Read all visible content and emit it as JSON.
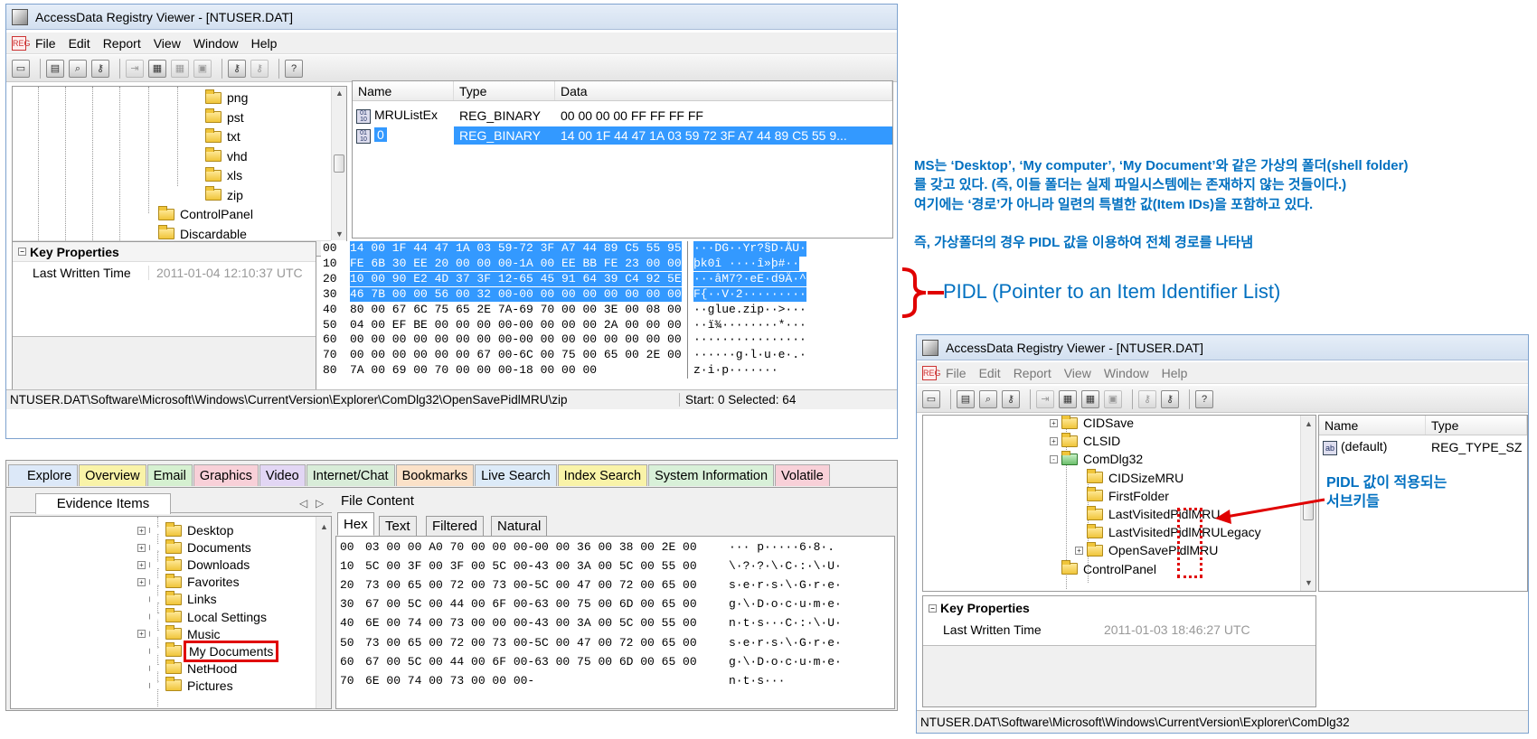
{
  "top_window": {
    "title": "AccessData Registry Viewer - [NTUSER.DAT]",
    "menu": [
      "File",
      "Edit",
      "Report",
      "View",
      "Window",
      "Help"
    ],
    "tree_items": [
      {
        "label": "png",
        "level": 2
      },
      {
        "label": "pst",
        "level": 2
      },
      {
        "label": "txt",
        "level": 2
      },
      {
        "label": "vhd",
        "level": 2
      },
      {
        "label": "xls",
        "level": 2
      },
      {
        "label": "zip",
        "level": 2,
        "open": true
      },
      {
        "label": "ControlPanel",
        "level": 1
      },
      {
        "label": "Discardable",
        "level": 1
      }
    ],
    "columns": [
      "Name",
      "Type",
      "Data"
    ],
    "values": [
      {
        "name": "MRUListEx",
        "type": "REG_BINARY",
        "data": "00 00 00 00 FF FF FF FF"
      },
      {
        "name": "0",
        "type": "REG_BINARY",
        "data": "14 00 1F 44 47 1A 03 59 72 3F A7 44 89 C5 55 9...",
        "selected": true
      }
    ],
    "key_properties_title": "Key Properties",
    "last_written_label": "Last Written Time",
    "last_written_value": "2011-01-04 12:10:37 UTC",
    "hex_rows": [
      {
        "off": "00",
        "hex": "14 00 1F 44 47 1A 03 59-72 3F A7 44 89 C5 55 95",
        "asc": "···DG··Yr?§D·ÅU·",
        "sel": true
      },
      {
        "off": "10",
        "hex": "FE 6B 30 EE 20 00 00 00-1A 00 EE BB FE 23 00 00",
        "asc": "þk0î ····î»þ#··",
        "sel": true
      },
      {
        "off": "20",
        "hex": "10 00 90 E2 4D 37 3F 12-65 45 91 64 39 C4 92 5E",
        "asc": "···âM7?·eE·d9Ä·^",
        "sel": true
      },
      {
        "off": "30",
        "hex": "46 7B 00 00 56 00 32 00-00 00 00 00 00 00 00 00",
        "asc": "F{··V·2·········",
        "sel": true
      },
      {
        "off": "40",
        "hex": "80 00 67 6C 75 65 2E 7A-69 70 00 00 3E 00 08 00",
        "asc": "··glue.zip··>···",
        "sel": false
      },
      {
        "off": "50",
        "hex": "04 00 EF BE 00 00 00 00-00 00 00 00 2A 00 00 00",
        "asc": "··ï¾········*···",
        "sel": false
      },
      {
        "off": "60",
        "hex": "00 00 00 00 00 00 00 00-00 00 00 00 00 00 00 00",
        "asc": "················",
        "sel": false
      },
      {
        "off": "70",
        "hex": "00 00 00 00 00 00 67 00-6C 00 75 00 65 00 2E 00",
        "asc": "······g·l·u·e·.·",
        "sel": false
      },
      {
        "off": "80",
        "hex": "7A 00 69 00 70 00 00 00-18 00 00 00",
        "asc": "z·i·p·······",
        "sel": false
      }
    ],
    "status_path": "NTUSER.DAT\\Software\\Microsoft\\Windows\\CurrentVersion\\Explorer\\ComDlg32\\OpenSavePidlMRU\\zip",
    "status_sel": "Start: 0 Selected: 64"
  },
  "ftk": {
    "tabs": [
      {
        "label": "Explore",
        "color": "#dce8f8"
      },
      {
        "label": "Overview",
        "color": "#f9f3a8"
      },
      {
        "label": "Email",
        "color": "#d5f0d0"
      },
      {
        "label": "Graphics",
        "color": "#f8d0d8"
      },
      {
        "label": "Video",
        "color": "#e2d6f4"
      },
      {
        "label": "Internet/Chat",
        "color": "#d8ecd8"
      },
      {
        "label": "Bookmarks",
        "color": "#fbe1c8"
      },
      {
        "label": "Live Search",
        "color": "#dceaf8"
      },
      {
        "label": "Index Search",
        "color": "#f9f3a8"
      },
      {
        "label": "System Information",
        "color": "#d8f0d8"
      },
      {
        "label": "Volatile",
        "color": "#f8d0d8"
      }
    ],
    "evidence_tab": "Evidence Items",
    "file_content": "File Content",
    "subtabs": [
      "Hex",
      "Text",
      "Filtered",
      "Natural"
    ],
    "tree": [
      {
        "label": "Desktop",
        "exp": true
      },
      {
        "label": "Documents",
        "exp": true
      },
      {
        "label": "Downloads",
        "exp": true
      },
      {
        "label": "Favorites",
        "exp": true
      },
      {
        "label": "Links",
        "exp": false
      },
      {
        "label": "Local Settings",
        "exp": false
      },
      {
        "label": "Music",
        "exp": true
      },
      {
        "label": "My Documents",
        "exp": false,
        "highlight": true
      },
      {
        "label": "NetHood",
        "exp": false
      },
      {
        "label": "Pictures",
        "exp": false
      }
    ],
    "hex_rows": [
      {
        "off": "00",
        "hex": "03 00 00 A0 70 00 00 00-00 00 36 00 38 00 2E 00",
        "asc": "··· p·····6·8·."
      },
      {
        "off": "10",
        "hex": "5C 00 3F 00 3F 00 5C 00-43 00 3A 00 5C 00 55 00",
        "asc": "\\·?·?·\\·C·:·\\·U·"
      },
      {
        "off": "20",
        "hex": "73 00 65 00 72 00 73 00-5C 00 47 00 72 00 65 00",
        "asc": "s·e·r·s·\\·G·r·e·"
      },
      {
        "off": "30",
        "hex": "67 00 5C 00 44 00 6F 00-63 00 75 00 6D 00 65 00",
        "asc": "g·\\·D·o·c·u·m·e·"
      },
      {
        "off": "40",
        "hex": "6E 00 74 00 73 00 00 00-43 00 3A 00 5C 00 55 00",
        "asc": "n·t·s···C·:·\\·U·"
      },
      {
        "off": "50",
        "hex": "73 00 65 00 72 00 73 00-5C 00 47 00 72 00 65 00",
        "asc": "s·e·r·s·\\·G·r·e·"
      },
      {
        "off": "60",
        "hex": "67 00 5C 00 44 00 6F 00-63 00 75 00 6D 00 65 00",
        "asc": "g·\\·D·o·c·u·m·e·"
      },
      {
        "off": "70",
        "hex": "6E 00 74 00 73 00 00 00-",
        "asc": "n·t·s···"
      }
    ]
  },
  "annotation": {
    "line1": "MS는 ‘Desktop’, ‘My computer’, ‘My Document’와 같은 가상의 폴더(shell folder)",
    "line2": "를 갖고 있다. (즉, 이들 폴더는 실제 파일시스템에는 존재하지 않는 것들이다.)",
    "line3": "여기에는 ‘경로’가 아니라 일련의 특별한 값(Item IDs)을 포함하고 있다.",
    "line4": "즉, 가상폴더의 경우 PIDL 값을 이용하여 전체 경로를 나타냄",
    "pidl": "PIDL (Pointer to an Item Identifier List)",
    "subkeys_l1": "PIDL 값이 적용되는",
    "subkeys_l2": "서브키들"
  },
  "right_window": {
    "title": "AccessData Registry Viewer - [NTUSER.DAT]",
    "menu": [
      "File",
      "Edit",
      "Report",
      "View",
      "Window",
      "Help"
    ],
    "tree": [
      {
        "label": "CIDSave",
        "indent": 0,
        "exp": "+"
      },
      {
        "label": "CLSID",
        "indent": 0,
        "exp": "+"
      },
      {
        "label": "ComDlg32",
        "indent": 0,
        "exp": "-",
        "open": true
      },
      {
        "label": "CIDSizeMRU",
        "indent": 1,
        "exp": ""
      },
      {
        "label": "FirstFolder",
        "indent": 1,
        "exp": ""
      },
      {
        "label": "LastVisitedPidlMRU",
        "indent": 1,
        "exp": ""
      },
      {
        "label": "LastVisitedPidlMRULegacy",
        "indent": 1,
        "exp": ""
      },
      {
        "label": "OpenSavePidlMRU",
        "indent": 1,
        "exp": "+"
      },
      {
        "label": "ControlPanel",
        "indent": 0,
        "exp": ""
      }
    ],
    "columns": [
      "Name",
      "Type"
    ],
    "values": [
      {
        "name": "(default)",
        "type": "REG_TYPE_SZ"
      }
    ],
    "key_properties_title": "Key Properties",
    "last_written_label": "Last Written Time",
    "last_written_value": "2011-01-03 18:46:27 UTC",
    "status_path": "NTUSER.DAT\\Software\\Microsoft\\Windows\\CurrentVersion\\Explorer\\ComDlg32"
  }
}
